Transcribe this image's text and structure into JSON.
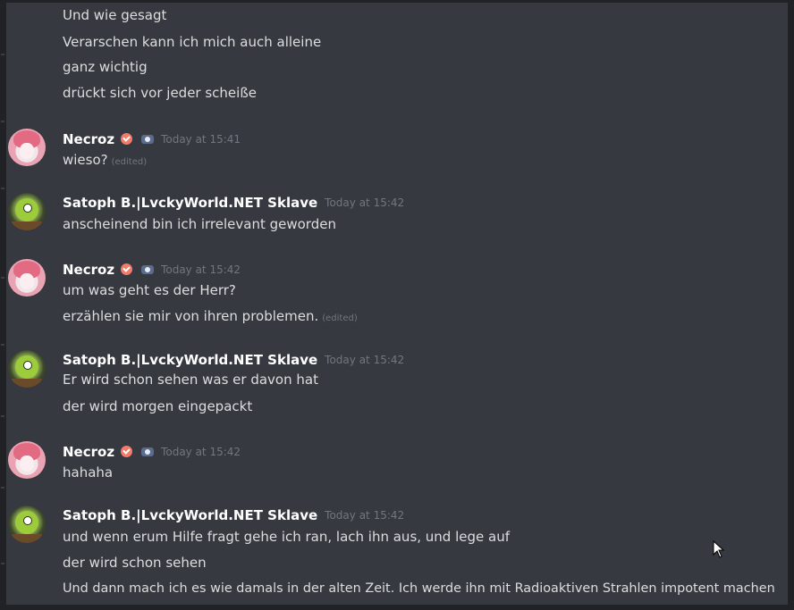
{
  "messages": [
    {
      "continuation": true,
      "lines": [
        {
          "text": "Und wie gesagt"
        },
        {
          "text": "Verarschen kann ich mich auch alleine"
        },
        {
          "text": "ganz wichtig"
        },
        {
          "text": "drückt sich vor jeder scheiße"
        }
      ]
    },
    {
      "author": "Necroz",
      "avatar_icon": "pink-hair-anime-avatar",
      "badges": [
        "verified-check-badge",
        "hypesquad-badge"
      ],
      "timestamp": "Today at 15:41",
      "lines": [
        {
          "text": "wieso?",
          "edited": "(edited)"
        }
      ]
    },
    {
      "author": "Satoph B.|LvckyWorld.NET Sklave",
      "avatar_icon": "green-one-eyed-monster-avatar",
      "timestamp": "Today at 15:42",
      "lines": [
        {
          "text": "anscheinend bin ich irrelevant geworden"
        }
      ]
    },
    {
      "author": "Necroz",
      "avatar_icon": "pink-hair-anime-avatar",
      "badges": [
        "verified-check-badge",
        "hypesquad-badge"
      ],
      "timestamp": "Today at 15:42",
      "lines": [
        {
          "text": "um was geht es der Herr?"
        },
        {
          "text": "erzählen sie mir von ihren problemen.",
          "edited": "(edited)"
        }
      ]
    },
    {
      "author": "Satoph B.|LvckyWorld.NET Sklave",
      "avatar_icon": "green-one-eyed-monster-avatar",
      "timestamp": "Today at 15:42",
      "lines": [
        {
          "text": "Er wird schon sehen was er davon hat"
        },
        {
          "text": "der wird morgen eingepackt"
        }
      ]
    },
    {
      "author": "Necroz",
      "avatar_icon": "pink-hair-anime-avatar",
      "badges": [
        "verified-check-badge",
        "hypesquad-badge"
      ],
      "timestamp": "Today at 15:42",
      "lines": [
        {
          "text": "hahaha"
        }
      ]
    },
    {
      "author": "Satoph B.|LvckyWorld.NET Sklave",
      "avatar_icon": "green-one-eyed-monster-avatar",
      "timestamp": "Today at 15:42",
      "lines": [
        {
          "text": "und wenn erum Hilfe fragt gehe ich ran, lach ihn aus, und lege auf"
        },
        {
          "text": "der wird schon sehen"
        },
        {
          "text": "Und dann mach ich es wie damals in der alten Zeit. Ich werde ihn mit Radioaktiven Strahlen impotent machen"
        }
      ]
    }
  ],
  "colors": {
    "background": "#36393f",
    "text": "#dcddde",
    "username": "#ffffff",
    "timestamp": "#72767d",
    "badge": "#f47b67"
  }
}
